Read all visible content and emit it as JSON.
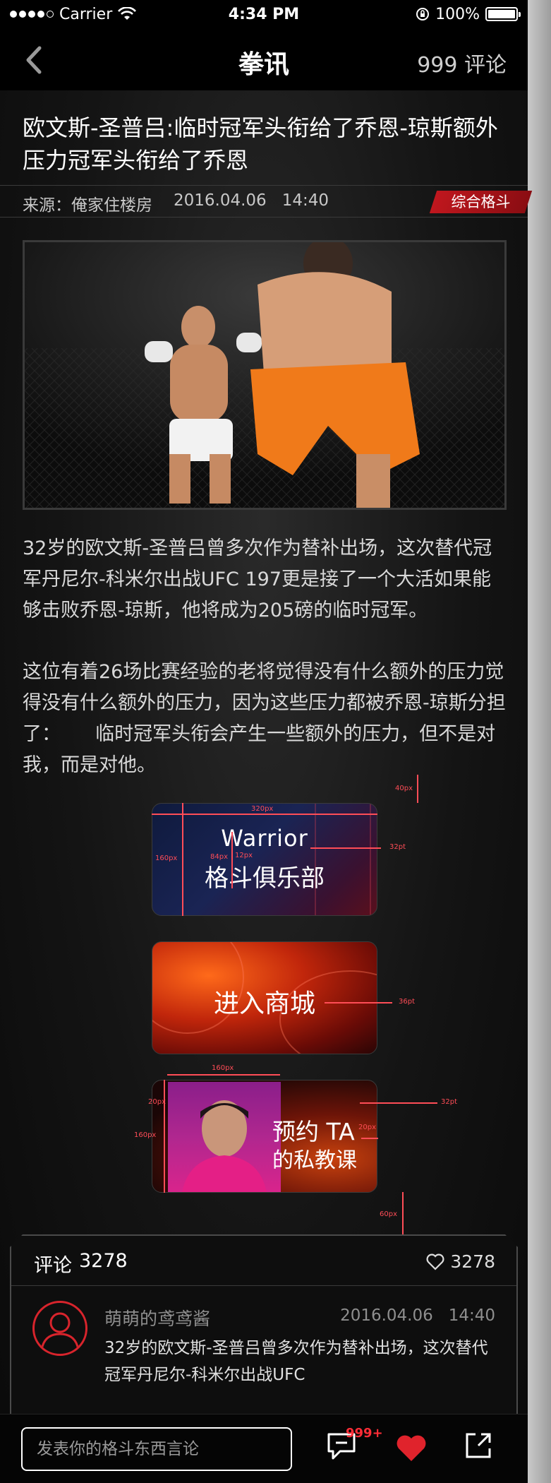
{
  "status_bar": {
    "carrier": "Carrier",
    "time": "4:34 PM",
    "battery": "100%"
  },
  "nav": {
    "title": "拳讯",
    "comments_count": "999 评论"
  },
  "article": {
    "title": "欧文斯-圣普吕:临时冠军头衔给了乔恩-琼斯额外压力冠军头衔给了乔恩",
    "source": "来源：俺家住楼房",
    "date": "2016.04.06",
    "time": "14:40",
    "tag": "综合格斗",
    "paragraphs": [
      "32岁的欧文斯-圣普吕曾多次作为替补出场，这次替代冠军丹尼尔-科米尔出战UFC 197更是接了一个大活如果能够击败乔恩-琼斯，他将成为205磅的临时冠军。",
      "这位有着26场比赛经验的老将觉得没有什么额外的压力觉得没有什么额外的压力，因为这些压力都被乔恩-琼斯分担了：　　 临时冠军头衔会产生一些额外的压力，但不是对我，而是对他。"
    ]
  },
  "cards": {
    "club_line1": "Warrior",
    "club_line2": "格斗俱乐部",
    "shop": "进入商城",
    "coach_line1": "预约 TA",
    "coach_line2": "的私教课"
  },
  "annotations": {
    "a1": "40px",
    "a2": "320px",
    "a3": "160px",
    "a4": "84px",
    "a5": "12px",
    "a6": "32pt",
    "a7": "36pt",
    "a8": "160px",
    "a9": "20px",
    "a10": "160px",
    "a11": "20px",
    "a12": "32pt",
    "a13": "60px"
  },
  "comments": {
    "label": "评论",
    "count": "3278",
    "likes": "3278",
    "items": [
      {
        "user": "萌萌的鸢鸢酱",
        "date": "2016.04.06",
        "time": "14:40",
        "text": "32岁的欧文斯-圣普吕曾多次作为替补出场，这次替代冠军丹尼尔-科米尔出战UFC"
      }
    ]
  },
  "bottom_bar": {
    "placeholder": "发表你的格斗东西言论",
    "badge": "999+"
  },
  "colors": {
    "accent": "#d8242c",
    "background": "#0b0b0b"
  },
  "icons": [
    "back-chevron-icon",
    "lock-rotation-icon",
    "wifi-icon",
    "battery-icon",
    "heart-icon",
    "comment-icon",
    "heart-filled-icon",
    "share-icon",
    "avatar-placeholder-icon"
  ]
}
